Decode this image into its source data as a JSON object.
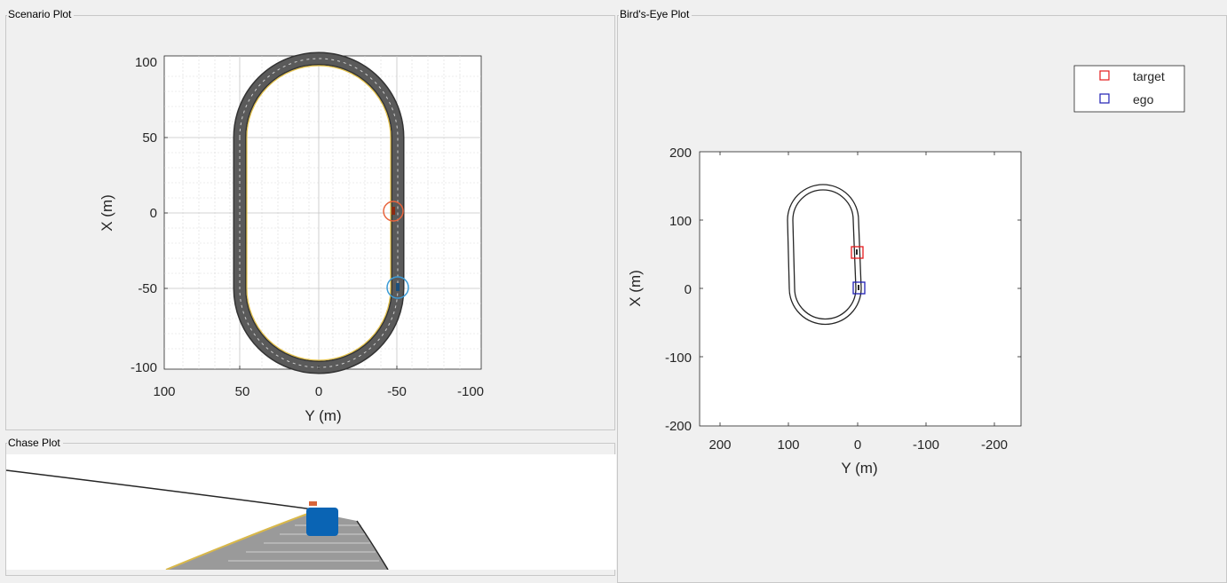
{
  "panels": {
    "scenario": {
      "title": "Scenario Plot"
    },
    "birdseye": {
      "title": "Bird's-Eye Plot"
    },
    "chase": {
      "title": "Chase Plot"
    }
  },
  "scenario_plot": {
    "xlabel": "Y (m)",
    "ylabel": "X (m)",
    "xticks": [
      "100",
      "50",
      "0",
      "-50",
      "-100"
    ],
    "yticks": [
      "100",
      "50",
      "0",
      "-50",
      "-100"
    ]
  },
  "birdseye_plot": {
    "xlabel": "Y (m)",
    "ylabel": "X (m)",
    "xticks": [
      "200",
      "100",
      "0",
      "-100",
      "-200"
    ],
    "yticks": [
      "200",
      "100",
      "0",
      "-100",
      "-200"
    ],
    "legend": {
      "items": [
        {
          "label": "target",
          "color": "#e41a1c"
        },
        {
          "label": "ego",
          "color": "#1f1fb4"
        }
      ]
    }
  },
  "colors": {
    "road": "#4d4d4d",
    "road_edge": "#333333",
    "lane_yellow": "#e6c34a",
    "target": "#e8643c",
    "ego": "#3c9bd6",
    "chase_ego": "#0a64b4"
  }
}
